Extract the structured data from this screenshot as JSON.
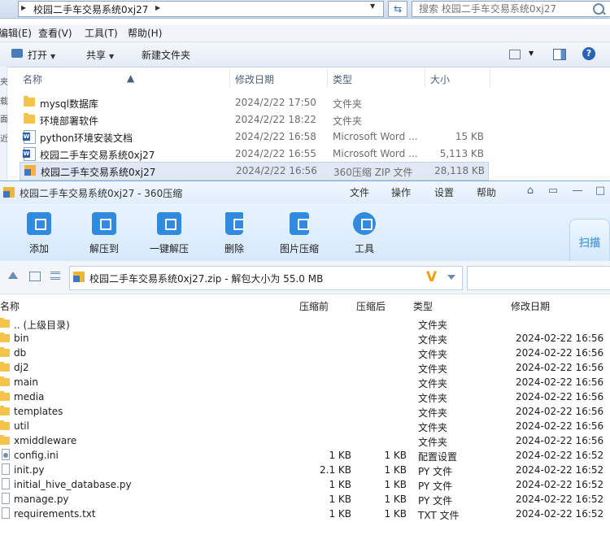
{
  "explorer": {
    "address_path": "校园二手车交易系统0xj27",
    "search_placeholder": "搜索 校园二手车交易系统0xj27",
    "menus": [
      "编辑(E)",
      "查看(V)",
      "工具(T)",
      "帮助(H)"
    ],
    "toolbar": {
      "open": "打开",
      "share": "共享",
      "new_folder": "新建文件夹"
    },
    "columns": {
      "name": "名称",
      "date": "修改日期",
      "type": "类型",
      "size": "大小"
    },
    "files": [
      {
        "icon": "folder-icon",
        "name": "mysql数据库",
        "date": "2024/2/22 17:50",
        "type": "文件夹",
        "size": ""
      },
      {
        "icon": "folder-icon",
        "name": "环境部署软件",
        "date": "2024/2/22 18:22",
        "type": "文件夹",
        "size": ""
      },
      {
        "icon": "word-doc-icon",
        "name": "python环境安装文档",
        "date": "2024/2/22 16:58",
        "type": "Microsoft Word ...",
        "size": "15 KB"
      },
      {
        "icon": "word-doc-icon",
        "name": "校园二手车交易系统0xj27",
        "date": "2024/2/22 16:55",
        "type": "Microsoft Word ...",
        "size": "5,113 KB"
      },
      {
        "icon": "zip-archive-icon",
        "name": "校园二手车交易系统0xj27",
        "date": "2024/2/22 16:56",
        "type": "360压缩 ZIP 文件",
        "size": "28,118 KB"
      }
    ],
    "left_strip": [
      "夹",
      "载",
      "面",
      "近"
    ]
  },
  "app360": {
    "title": "校园二手车交易系统0xj27 - 360压缩",
    "title_menus": [
      "文件",
      "操作",
      "设置",
      "帮助"
    ],
    "ribbon": [
      "添加",
      "解压到",
      "一键解压",
      "删除",
      "图片压缩",
      "工具"
    ],
    "scan_label": "扫描",
    "path_text": "校园二手车交易系统0xj27.zip - 解包大小为 55.0 MB",
    "columns": {
      "name": "名称",
      "before": "压缩前",
      "after": "压缩后",
      "type": "类型",
      "date": "修改日期"
    },
    "rows": [
      {
        "kind": "folder",
        "name": ".. (上级目录)",
        "before": "",
        "after": "",
        "type": "文件夹",
        "date": ""
      },
      {
        "kind": "folder",
        "name": "bin",
        "before": "",
        "after": "",
        "type": "文件夹",
        "date": "2024-02-22 16:56"
      },
      {
        "kind": "folder",
        "name": "db",
        "before": "",
        "after": "",
        "type": "文件夹",
        "date": "2024-02-22 16:56"
      },
      {
        "kind": "folder",
        "name": "dj2",
        "before": "",
        "after": "",
        "type": "文件夹",
        "date": "2024-02-22 16:56"
      },
      {
        "kind": "folder",
        "name": "main",
        "before": "",
        "after": "",
        "type": "文件夹",
        "date": "2024-02-22 16:56"
      },
      {
        "kind": "folder",
        "name": "media",
        "before": "",
        "after": "",
        "type": "文件夹",
        "date": "2024-02-22 16:56"
      },
      {
        "kind": "folder",
        "name": "templates",
        "before": "",
        "after": "",
        "type": "文件夹",
        "date": "2024-02-22 16:56"
      },
      {
        "kind": "folder",
        "name": "util",
        "before": "",
        "after": "",
        "type": "文件夹",
        "date": "2024-02-22 16:56"
      },
      {
        "kind": "folder",
        "name": "xmiddleware",
        "before": "",
        "after": "",
        "type": "文件夹",
        "date": "2024-02-22 16:56"
      },
      {
        "kind": "cfg",
        "name": "config.ini",
        "before": "1 KB",
        "after": "1 KB",
        "type": "配置设置",
        "date": "2024-02-22 16:52"
      },
      {
        "kind": "file",
        "name": "init.py",
        "before": "2.1 KB",
        "after": "1 KB",
        "type": "PY 文件",
        "date": "2024-02-22 16:52"
      },
      {
        "kind": "file",
        "name": "initial_hive_database.py",
        "before": "1 KB",
        "after": "1 KB",
        "type": "PY 文件",
        "date": "2024-02-22 16:52"
      },
      {
        "kind": "file",
        "name": "manage.py",
        "before": "1 KB",
        "after": "1 KB",
        "type": "PY 文件",
        "date": "2024-02-22 16:52"
      },
      {
        "kind": "file",
        "name": "requirements.txt",
        "before": "1 KB",
        "after": "1 KB",
        "type": "TXT 文件",
        "date": "2024-02-22 16:52"
      }
    ]
  },
  "colors": {
    "accent": "#2f8ae0",
    "folder": "#f4c349",
    "selection": "#dfe8f4"
  }
}
